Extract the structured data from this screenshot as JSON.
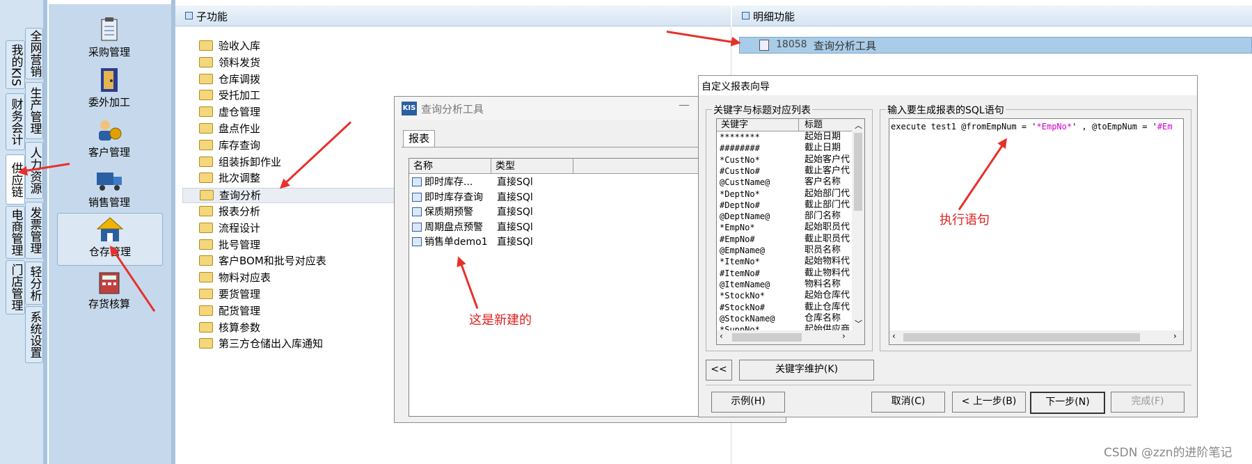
{
  "left_tabs": [
    "全网营销",
    "我的KIS",
    "生产管理",
    "财务会计",
    "人力资源",
    "供应链",
    "发票管理",
    "电商管理",
    "轻分析",
    "门店管理",
    "系统设置"
  ],
  "modules": [
    "采购管理",
    "委外加工",
    "客户管理",
    "销售管理",
    "仓存管理",
    "存货核算"
  ],
  "sub_panel_title": "子功能",
  "detail_panel_title": "明细功能",
  "sub_items": [
    "验收入库",
    "领料发货",
    "仓库调拨",
    "受托加工",
    "虚仓管理",
    "盘点作业",
    "库存查询",
    "组装拆卸作业",
    "批次调整",
    "查询分析",
    "报表分析",
    "流程设计",
    "批号管理",
    "客户BOM和批号对应表",
    "物料对应表",
    "要货管理",
    "配货管理",
    "核算参数",
    "第三方仓储出入库通知"
  ],
  "detail_item": {
    "code": "18058",
    "label": "查询分析工具"
  },
  "query_window": {
    "logo": "KIS",
    "title": "查询分析工具",
    "tab": "报表",
    "columns": [
      "名称",
      "类型"
    ],
    "rows": [
      {
        "name": "即时库存...",
        "type": "直接SQl"
      },
      {
        "name": "即时库存查询",
        "type": "直接SQl"
      },
      {
        "name": "保质期预警",
        "type": "直接SQl"
      },
      {
        "name": "周期盘点预警",
        "type": "直接SQl"
      },
      {
        "name": "销售单demo1",
        "type": "直接SQl"
      }
    ]
  },
  "wizard": {
    "title": "自定义报表向导",
    "group_left": "关键字与标题对应列表",
    "group_right": "输入要生成报表的SQL语句",
    "columns": [
      "关键字",
      "标题"
    ],
    "rows": [
      {
        "k": "********",
        "t": "起始日期"
      },
      {
        "k": "########",
        "t": "截止日期"
      },
      {
        "k": "*CustNo*",
        "t": "起始客户代"
      },
      {
        "k": "#CustNo#",
        "t": "截止客户代"
      },
      {
        "k": "@CustName@",
        "t": "客户名称"
      },
      {
        "k": "*DeptNo*",
        "t": "起始部门代"
      },
      {
        "k": "#DeptNo#",
        "t": "截止部门代"
      },
      {
        "k": "@DeptName@",
        "t": "部门名称"
      },
      {
        "k": "*EmpNo*",
        "t": "起始职员代"
      },
      {
        "k": "#EmpNo#",
        "t": "截止职员代"
      },
      {
        "k": "@EmpName@",
        "t": "职员名称"
      },
      {
        "k": "*ItemNo*",
        "t": "起始物料代"
      },
      {
        "k": "#ItemNo#",
        "t": "截止物料代"
      },
      {
        "k": "@ItemName@",
        "t": "物料名称"
      },
      {
        "k": "*StockNo*",
        "t": "起始仓库代"
      },
      {
        "k": "#StockNo#",
        "t": "截止仓库代"
      },
      {
        "k": "@StockName@",
        "t": "仓库名称"
      },
      {
        "k": "*SuppNo*",
        "t": "起始供应商"
      }
    ],
    "sql_plain": "execute test1 @fromEmpNum = '",
    "sql_kw1": "*EmpNo*",
    "sql_mid": "' , @toEmpNum = '",
    "sql_kw2": "#Em",
    "back_btn": "<<",
    "keyword_btn": "关键字维护(K)",
    "example_btn": "示例(H)",
    "cancel_btn": "取消(C)",
    "prev_btn": "< 上一步(B)",
    "next_btn": "下一步(N)",
    "finish_btn": "完成(F)"
  },
  "annotations": {
    "new_note": "这是新建的",
    "exec_note": "执行语句"
  },
  "watermark": "CSDN @zzn的进阶笔记",
  "colors": {
    "arrow": "#e8302a",
    "sql_keyword": "#d000d0"
  }
}
